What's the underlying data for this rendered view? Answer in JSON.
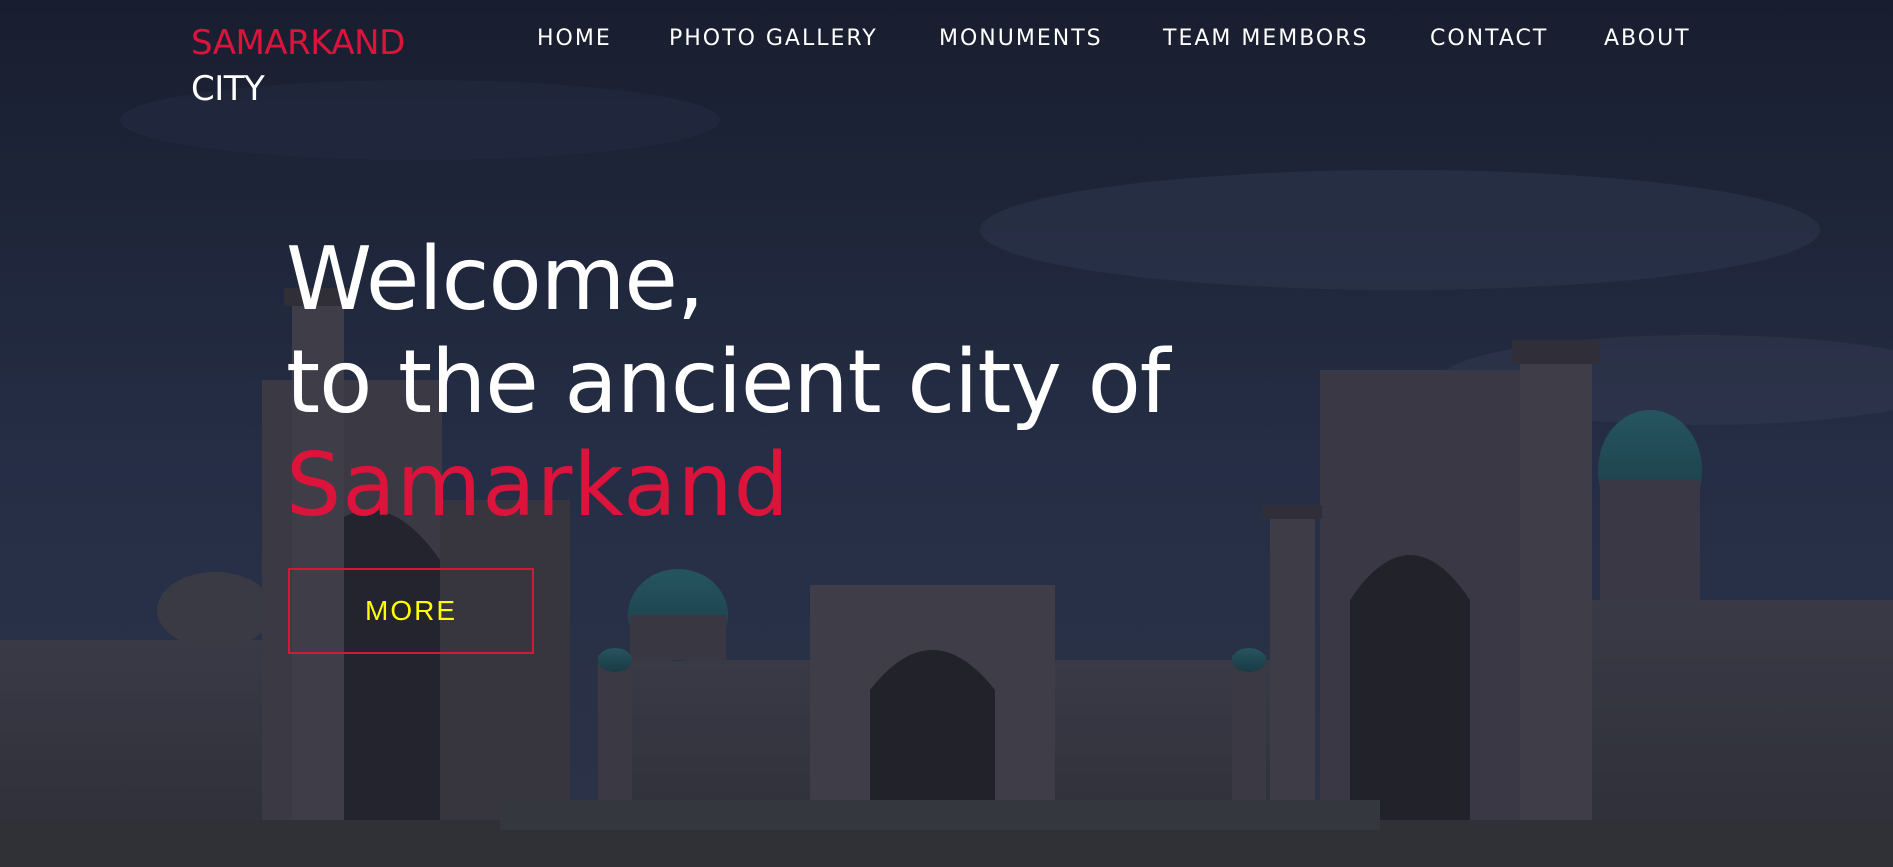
{
  "brand": {
    "line1": "SAMARKAND",
    "line2": "CITY",
    "accent_color": "#dc143c"
  },
  "nav": {
    "items": [
      {
        "label": "HOME"
      },
      {
        "label": "PHOTO GALLERY"
      },
      {
        "label": "MONUMENTS"
      },
      {
        "label": "TEAM MEMBORS"
      },
      {
        "label": "CONTACT"
      },
      {
        "label": "ABOUT"
      }
    ]
  },
  "hero": {
    "line1": "Welcome,",
    "line2": "to the ancient city of",
    "city": "Samarkand",
    "button_label": "MORE",
    "button_text_color": "#ffff00",
    "background_image": "registan-square-photo"
  }
}
